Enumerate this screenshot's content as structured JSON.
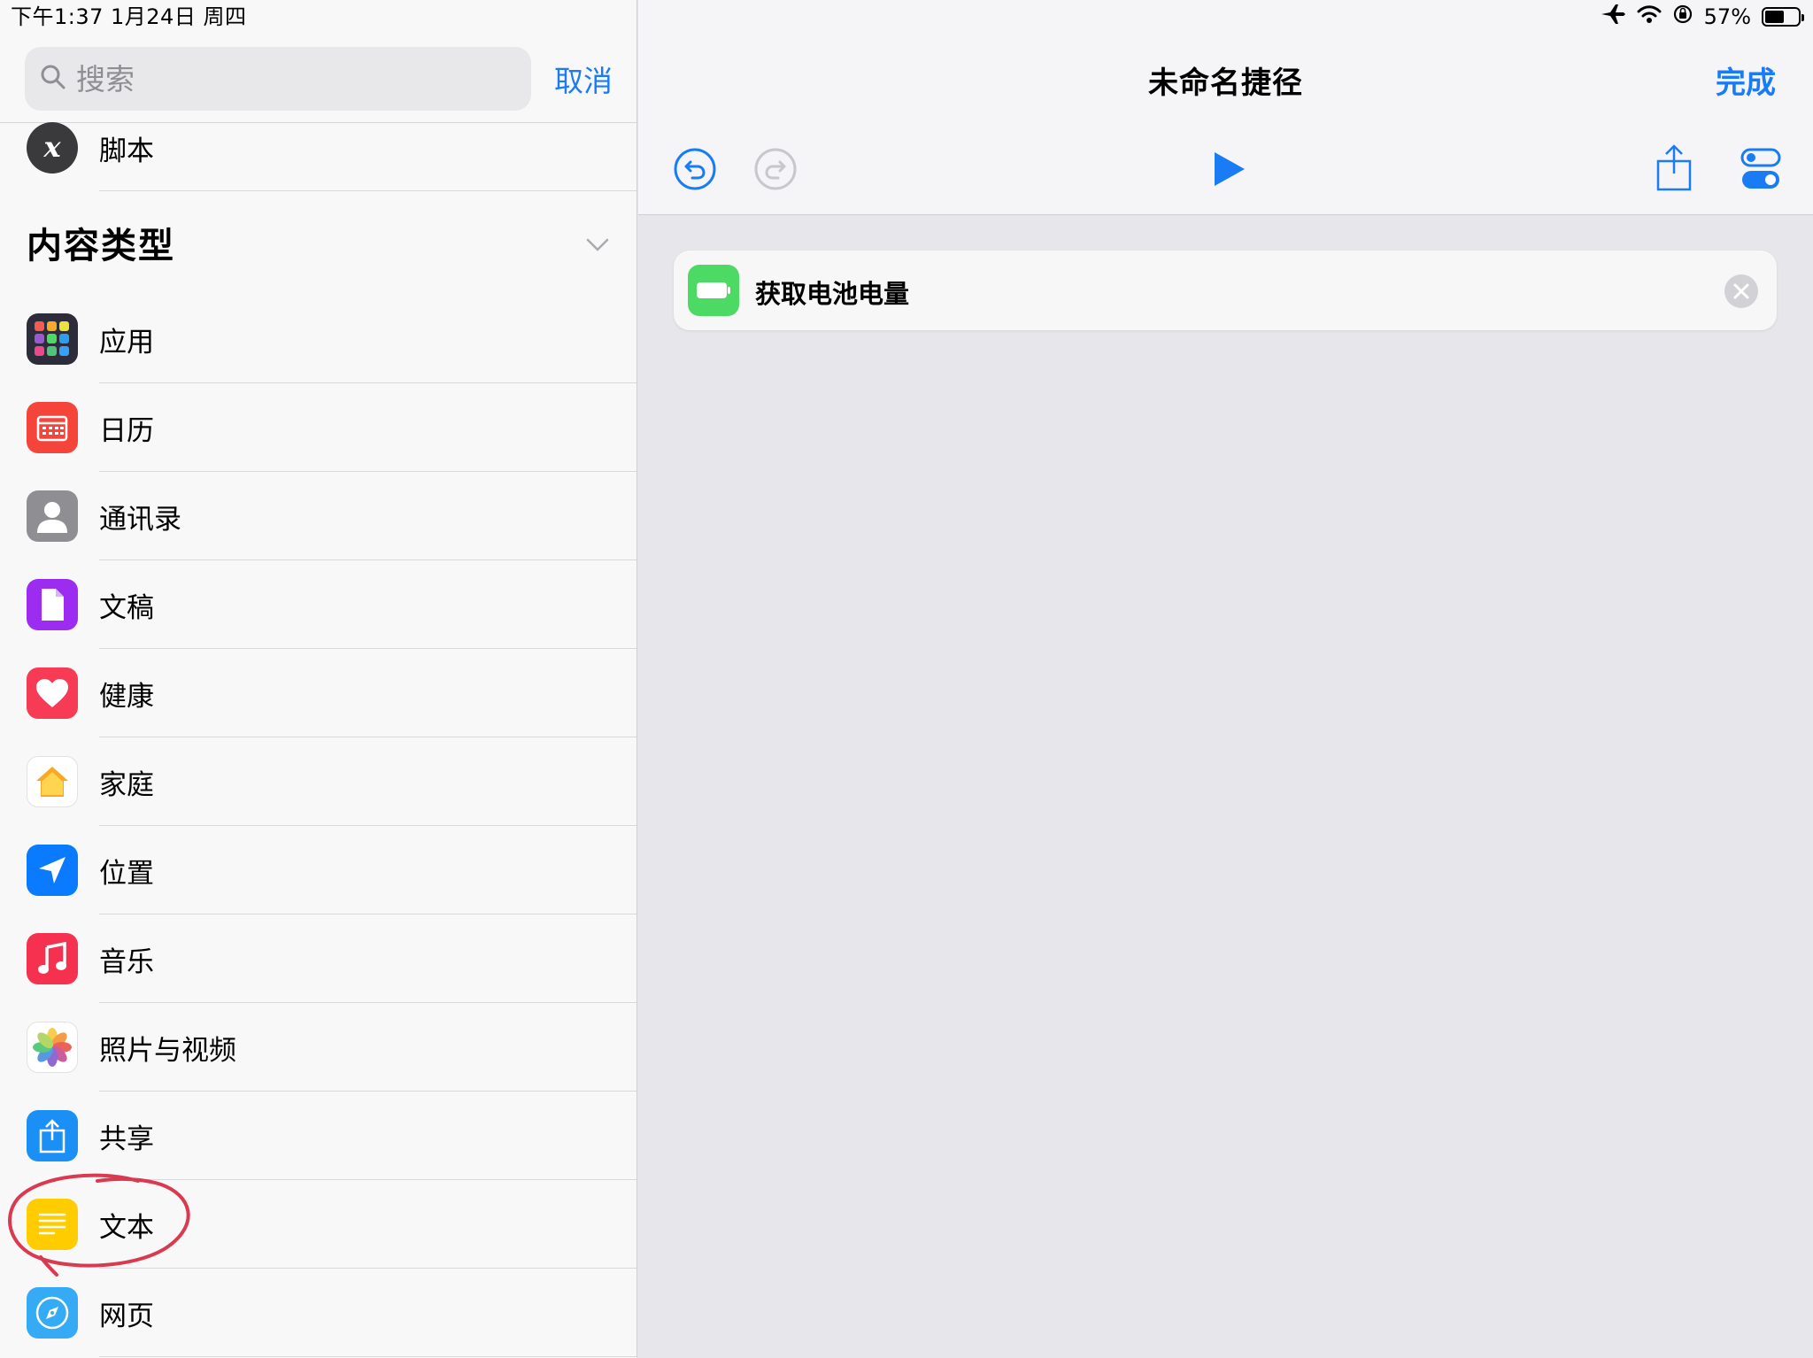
{
  "status_bar": {
    "time_date": "下午1:37   1月24日 周四",
    "battery_text": "57%",
    "battery_level": 0.57,
    "icons": [
      "airplane-icon",
      "wifi-icon",
      "orientation-lock-icon",
      "battery-icon"
    ]
  },
  "search": {
    "placeholder": "搜索",
    "cancel_label": "取消"
  },
  "sidebar": {
    "top_item": {
      "label": "脚本",
      "icon": "script-x-icon"
    },
    "section_title": "内容类型",
    "items": [
      {
        "label": "应用",
        "icon": "apps-grid-icon",
        "color": "#2c2c3a"
      },
      {
        "label": "日历",
        "icon": "calendar-icon",
        "color": "#f5453a"
      },
      {
        "label": "通讯录",
        "icon": "contacts-icon",
        "color": "#8e8e93"
      },
      {
        "label": "文稿",
        "icon": "document-icon",
        "color": "#9b2cf0"
      },
      {
        "label": "健康",
        "icon": "heart-icon",
        "color": "#f73b55"
      },
      {
        "label": "家庭",
        "icon": "home-icon",
        "color": "#ffffff"
      },
      {
        "label": "位置",
        "icon": "location-arrow-icon",
        "color": "#0a7bff"
      },
      {
        "label": "音乐",
        "icon": "music-note-icon",
        "color": "#f6304f"
      },
      {
        "label": "照片与视频",
        "icon": "photos-icon",
        "color": "#ffffff"
      },
      {
        "label": "共享",
        "icon": "share-icon",
        "color": "#1a8ff5"
      },
      {
        "label": "文本",
        "icon": "text-lines-icon",
        "color": "#ffcc00"
      },
      {
        "label": "网页",
        "icon": "safari-compass-icon",
        "color": "#35aaf5"
      }
    ]
  },
  "detail": {
    "title": "未命名捷径",
    "done_label": "完成",
    "toolbar": [
      "undo-icon",
      "redo-icon",
      "play-icon",
      "share-icon",
      "settings-toggle-icon"
    ],
    "actions": [
      {
        "label": "获取电池电量",
        "icon": "battery-action-icon",
        "color": "#4cd964"
      }
    ]
  },
  "accent_color": "#1a7cf5"
}
